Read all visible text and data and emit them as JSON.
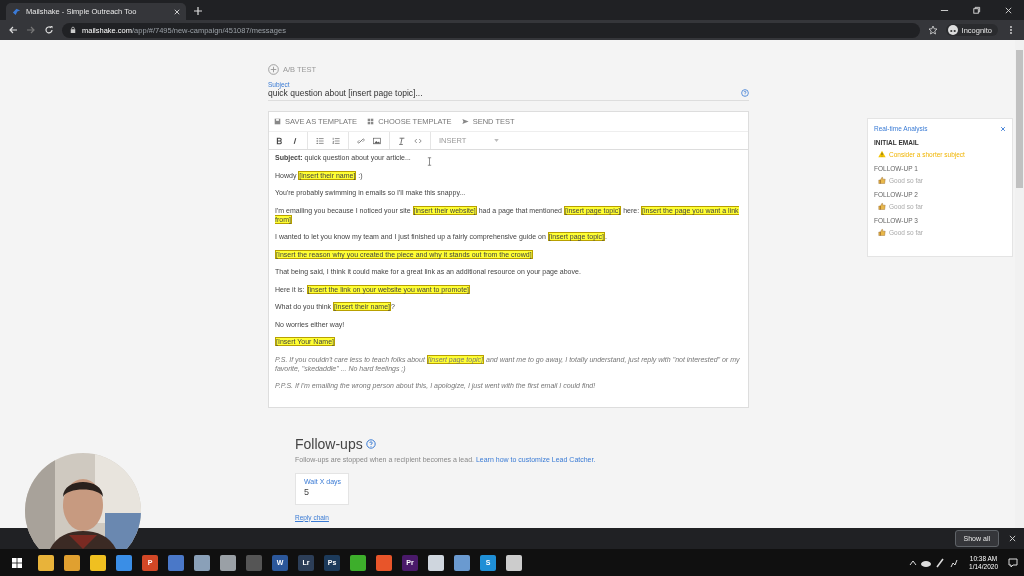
{
  "browser": {
    "tab_title": "Mailshake - Simple Outreach Too",
    "url_host": "mailshake.com",
    "url_path": "/app/#/7495/new-campaign/451087/messages",
    "profile": "Incognito"
  },
  "ab_test": "A/B TEST",
  "subject": {
    "label": "Subject",
    "value": "quick question about [insert page topic]..."
  },
  "editor_actions": [
    "SAVE AS TEMPLATE",
    "CHOOSE TEMPLATE",
    "SEND TEST"
  ],
  "insert_menu": "INSERT",
  "body": [
    {
      "kind": "plain",
      "segments": [
        {
          "text": "**Subject:** quick question about your article...",
          "placeholder": false
        }
      ]
    },
    {
      "kind": "plain",
      "segments": [
        {
          "text": "Howdy ",
          "placeholder": false
        },
        {
          "text": "[insert their name]",
          "placeholder": true
        },
        {
          "text": " :)",
          "placeholder": false
        }
      ]
    },
    {
      "kind": "plain",
      "segments": [
        {
          "text": "You're probably swimming in emails so I'll make this snappy...",
          "placeholder": false
        }
      ]
    },
    {
      "kind": "plain",
      "segments": [
        {
          "text": "I'm emailing you because I noticed your site ",
          "placeholder": false
        },
        {
          "text": "[insert their website]",
          "placeholder": true
        },
        {
          "text": " had a page that mentioned ",
          "placeholder": false
        },
        {
          "text": "[insert page topic]",
          "placeholder": true
        },
        {
          "text": " here: ",
          "placeholder": false
        },
        {
          "text": "[insert the page you want a link from]",
          "placeholder": true
        }
      ]
    },
    {
      "kind": "plain",
      "segments": [
        {
          "text": "I wanted to let you know my team and I just finished up a fairly comprehensive guide on  ",
          "placeholder": false
        },
        {
          "text": "[insert page topic]",
          "placeholder": true
        },
        {
          "text": ".",
          "placeholder": false
        }
      ]
    },
    {
      "kind": "plain",
      "segments": [
        {
          "text": "[Insert the reason why you created the piece and why it stands out from the crowd]",
          "placeholder": true
        }
      ]
    },
    {
      "kind": "plain",
      "segments": [
        {
          "text": "That being said, I think it could make for a great link as an additional resource on your page above.",
          "placeholder": false
        }
      ]
    },
    {
      "kind": "plain",
      "segments": [
        {
          "text": "Here it is: ",
          "placeholder": false
        },
        {
          "text": "[insert the link on your website you want to promote]",
          "placeholder": true
        }
      ]
    },
    {
      "kind": "plain",
      "segments": [
        {
          "text": "What do you think ",
          "placeholder": false
        },
        {
          "text": "[insert their name]",
          "placeholder": true
        },
        {
          "text": "?",
          "placeholder": false
        }
      ]
    },
    {
      "kind": "plain",
      "segments": [
        {
          "text": "No worries either way!",
          "placeholder": false
        }
      ]
    },
    {
      "kind": "plain",
      "segments": [
        {
          "text": "[Insert Your Name]",
          "placeholder": true
        }
      ]
    },
    {
      "kind": "italic",
      "segments": [
        {
          "text": "P.S. If you couldn't care less to teach folks about ",
          "placeholder": false
        },
        {
          "text": "[insert page topic]",
          "placeholder": true
        },
        {
          "text": " and want me to go away, I totally understand, just reply with \"not interested\" or my favorite, \"skedaddle\" ... No hard feelings ;)",
          "placeholder": false
        }
      ]
    },
    {
      "kind": "italic",
      "segments": [
        {
          "text": "P.P.S. If I'm emailing the wrong person about this, I apologize, I just went with the first email I could find!",
          "placeholder": false
        }
      ]
    }
  ],
  "analysis": {
    "title": "Real-time Analysis",
    "items": [
      {
        "heading": "INITIAL EMAIL",
        "kind": "warning",
        "message": "Consider a shorter subject"
      },
      {
        "heading": "FOLLOW-UP 1",
        "kind": "good",
        "message": "Good so far"
      },
      {
        "heading": "FOLLOW-UP 2",
        "kind": "good",
        "message": "Good so far"
      },
      {
        "heading": "FOLLOW-UP 3",
        "kind": "good",
        "message": "Good so far"
      }
    ]
  },
  "followups": {
    "title": "Follow-ups",
    "description": "Follow-ups are stopped when a recipient becomes a lead.",
    "link": "Learn how to customize Lead Catcher.",
    "wait_label": "Wait X days",
    "wait_value": "5",
    "reply_chain": "Reply chain"
  },
  "download_bar": {
    "show_all": "Show all"
  },
  "taskbar": {
    "apps": [
      {
        "color": "#e8b33a"
      },
      {
        "color": "#e0a030"
      },
      {
        "color": "#f0c020"
      },
      {
        "color": "#3a8ee6"
      },
      {
        "label": "P",
        "color": "#d24726"
      },
      {
        "color": "#4a78c8"
      },
      {
        "color": "#8aa0b8"
      },
      {
        "color": "#9aa0a6"
      },
      {
        "color": "#555555"
      },
      {
        "label": "W",
        "color": "#2b579a"
      },
      {
        "label": "Lr",
        "color": "#2c3e57"
      },
      {
        "label": "Ps",
        "color": "#1c3a5a"
      },
      {
        "color": "#3dae2b"
      },
      {
        "color": "#e8552a"
      },
      {
        "label": "Pr",
        "color": "#4a1a6a"
      },
      {
        "color": "#cfd6de"
      },
      {
        "color": "#6a9ad0"
      },
      {
        "label": "S",
        "color": "#1f8fd6"
      },
      {
        "color": "#cccccc"
      }
    ],
    "time": "10:38 AM",
    "date": "1/14/2020"
  }
}
